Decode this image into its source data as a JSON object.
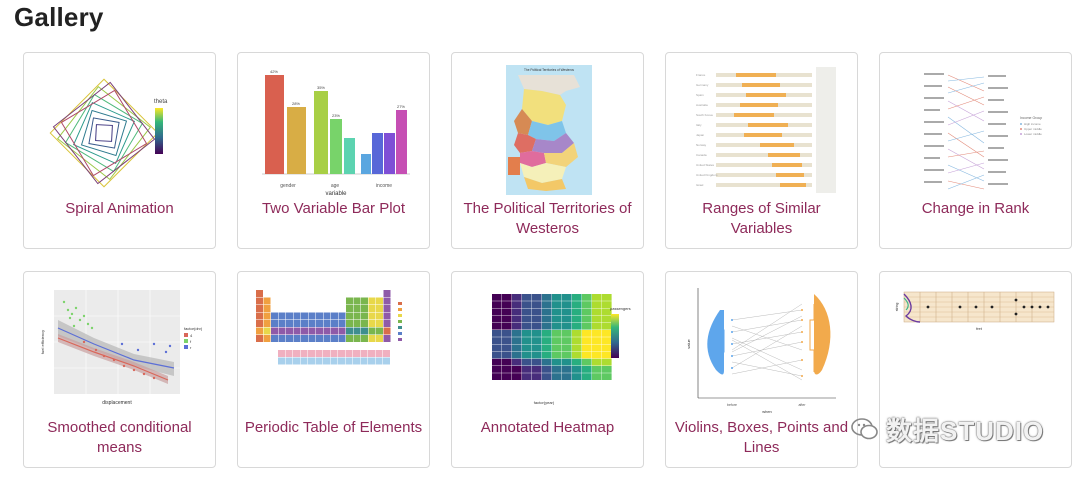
{
  "page": {
    "title": "Gallery"
  },
  "cards": [
    {
      "caption": "Spiral Animation"
    },
    {
      "caption": "Two Variable Bar Plot"
    },
    {
      "caption": "The Political Territories of Westeros"
    },
    {
      "caption": "Ranges of Similar Variables"
    },
    {
      "caption": "Change in Rank"
    },
    {
      "caption": "Smoothed conditional means"
    },
    {
      "caption": "Periodic Table of Elements"
    },
    {
      "caption": "Annotated Heatmap"
    },
    {
      "caption": "Violins, Boxes, Points and Lines"
    },
    {
      "caption": ""
    }
  ],
  "thumb_labels": {
    "spiral_legend": "theta",
    "bar_xlabel": "variable",
    "scatter_xlabel": "displacement",
    "scatter_ylabel": "fuel efficiency",
    "scatter_legend": "factor(drv)",
    "heatmap_xlabel": "factor(year)",
    "heatmap_legend": "passengers",
    "violin_ylabel": "value",
    "violin_xlabel": "when",
    "violin_groups": [
      "before",
      "after"
    ],
    "rank_legend": "Income Group",
    "territories_title": "The Political Territories of Westeros",
    "last_xlabel": "fret",
    "last_ylabel": "string"
  },
  "watermark": {
    "text": "数据STUDIO"
  },
  "colors": {
    "link": "#8e2a5a",
    "border": "#d8d8d8",
    "title": "#222222"
  }
}
